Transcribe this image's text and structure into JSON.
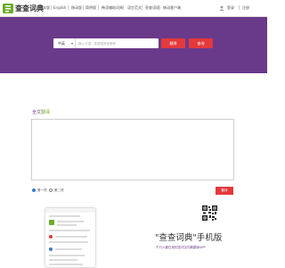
{
  "brand": {
    "name": "查查词典"
  },
  "nav": [
    {
      "label": "整本版"
    },
    {
      "label": "English"
    },
    {
      "label": "移动版"
    },
    {
      "label": "简明版"
    },
    {
      "label": "韩语辅助词典"
    },
    {
      "label": "语言范文"
    },
    {
      "label": "智查语境"
    },
    {
      "label": "移动客户端"
    }
  ],
  "auth": {
    "login": "登录",
    "register": "注册"
  },
  "search": {
    "lang": "中英",
    "placeholder": "输入汉语、英语或其他语种",
    "translate_btn": "翻译",
    "lookup_btn": "查询"
  },
  "translate": {
    "title_part1": "全文",
    "title_part2": "翻译",
    "radio1": "第一项",
    "radio2": "第二项",
    "submit": "翻译"
  },
  "promo": {
    "title": "\"查查词典\"手机版",
    "subtitle": "千万人都在用的查词汉词典翻译APP"
  },
  "colors": {
    "banner": "#6a3a8a",
    "accent": "#e4393c",
    "logo": "#6cab2b"
  }
}
